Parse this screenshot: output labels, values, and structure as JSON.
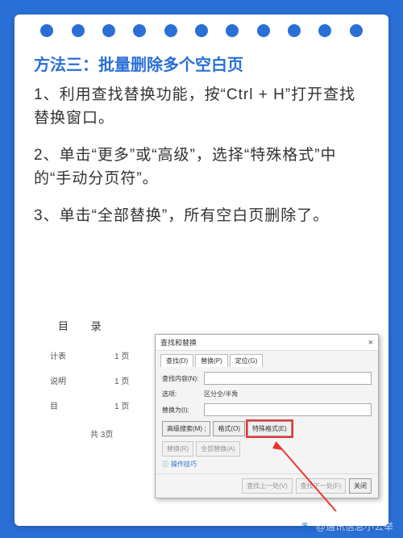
{
  "title": "方法三：批量删除多个空白页",
  "para1": "1、利用查找替换功能，按“Ctrl + H”打开查找替换窗口。",
  "para2": "2、单击“更多”或“高级”，选择“特殊格式”中的“手动分页符”。",
  "para3": "3、单击“全部替换”，所有空白页删除了。",
  "doc": {
    "heading": "目  录",
    "rows": [
      {
        "a": "计表",
        "b": "1 页"
      },
      {
        "a": "说明",
        "b": "1 页"
      },
      {
        "a": "目",
        "b": "1 页"
      }
    ],
    "total": "共  3页"
  },
  "dialog": {
    "title": "查找和替换",
    "tabs": [
      "查找(D)",
      "替换(P)",
      "定位(G)"
    ],
    "findLabel": "查找内容(N):",
    "optionsLabel": "选项:",
    "optionsText": "区分全/半角",
    "replaceLabel": "替换为(I):",
    "btns1": [
      "高级搜索(M) ;",
      "格式(O)",
      "特殊格式(E)"
    ],
    "btns2": [
      "替换(R)",
      "全部替换(A)"
    ],
    "hint": "操作技巧",
    "footer": [
      "查找上一处(V)",
      "查找下一处(F)",
      "关闭"
    ]
  },
  "watermark": "@通讯信息小公举"
}
